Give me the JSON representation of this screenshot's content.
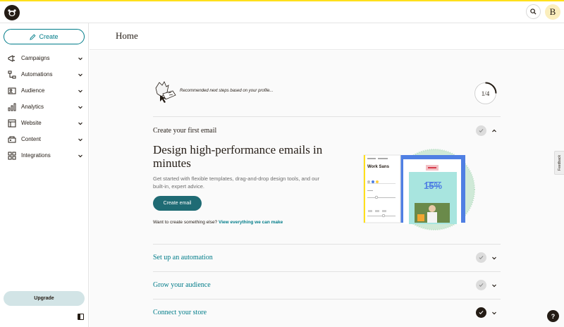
{
  "header": {
    "logo": "mailchimp-freddie-icon",
    "avatar_initial": "B"
  },
  "sidebar": {
    "create_label": "Create",
    "items": [
      {
        "label": "Campaigns",
        "icon": "megaphone-icon"
      },
      {
        "label": "Automations",
        "icon": "automation-flow-icon"
      },
      {
        "label": "Audience",
        "icon": "audience-icon"
      },
      {
        "label": "Analytics",
        "icon": "bar-chart-icon"
      },
      {
        "label": "Website",
        "icon": "website-icon"
      },
      {
        "label": "Content",
        "icon": "content-icon"
      },
      {
        "label": "Integrations",
        "icon": "grid-icon"
      }
    ],
    "upgrade_label": "Upgrade"
  },
  "page": {
    "title": "Home"
  },
  "recommendations": {
    "text": "Recommended next steps based on your profile...",
    "progress_label": "1/4",
    "progress_fraction": 0.25
  },
  "steps": {
    "email": {
      "title": "Create your first email",
      "heading": "Design high-performance emails in minutes",
      "description": "Get started with flexible templates, drag-and-drop design tools, and our built-in, expert advice.",
      "cta": "Create email",
      "alt_prefix": "Want to create something else?",
      "alt_link": "View everything we can make"
    },
    "automation": {
      "title": "Set up an automation"
    },
    "audience": {
      "title": "Grow your audience"
    },
    "store": {
      "title": "Connect your store"
    }
  },
  "illustration": {
    "font_label": "Work Sans",
    "promo_text": "15%"
  },
  "feedback_label": "Feedback",
  "help_label": "?",
  "colors": {
    "brand_yellow": "#ffe01b",
    "teal": "#007c89",
    "cta_teal": "#1f6b74",
    "dark": "#241c15"
  }
}
